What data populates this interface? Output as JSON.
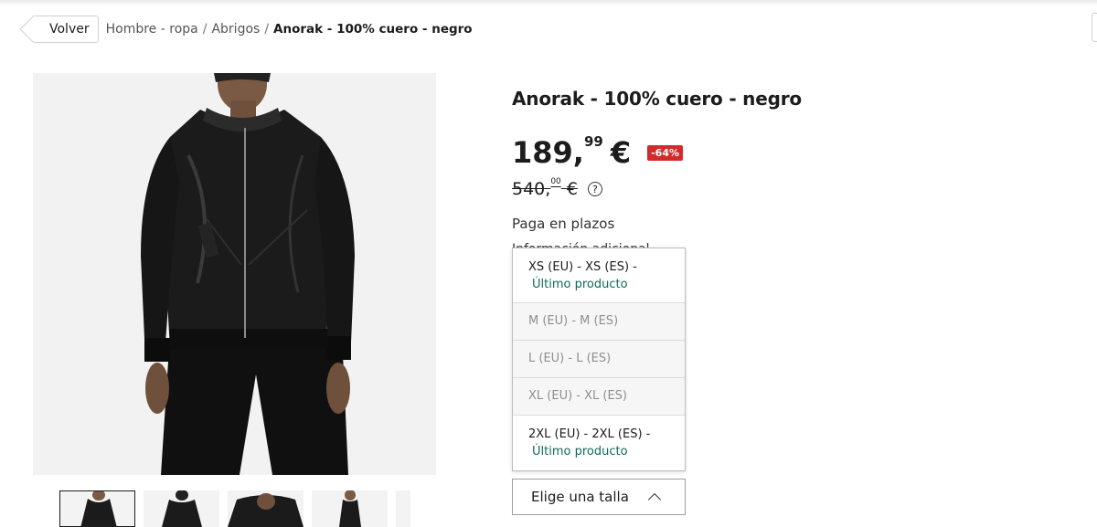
{
  "breadcrumb": {
    "back_label": "Volver",
    "items": [
      "Hombre - ropa",
      "Abrigos"
    ],
    "separator": "/",
    "current": "Anorak - 100% cuero - negro"
  },
  "product": {
    "title": "Anorak - 100% cuero - negro",
    "price": {
      "integer": "189,",
      "cents": "99",
      "currency": "€",
      "discount_badge": "-64%",
      "old_integer": "540,",
      "old_cents": "00",
      "old_currency": "€"
    },
    "installments_label": "Paga en plazos",
    "additional_info_label": "Información adicional"
  },
  "size_selector": {
    "label": "Elige una talla",
    "options": [
      {
        "label": "XS (EU) - XS (ES) -",
        "status": "Último producto",
        "available": true
      },
      {
        "label": "M (EU) - M (ES)",
        "status": "",
        "available": false
      },
      {
        "label": "L (EU) - L (ES)",
        "status": "",
        "available": false
      },
      {
        "label": "XL (EU) - XL (ES)",
        "status": "",
        "available": false
      },
      {
        "label": "2XL (EU) - 2XL (ES) -",
        "status": "Último producto",
        "available": true
      }
    ]
  },
  "gallery": {
    "thumbnails": [
      "front-view",
      "back-view",
      "detail-view",
      "side-view",
      "more"
    ]
  },
  "colors": {
    "discount": "#d22b2b",
    "availability": "#0e6b5a",
    "text": "#1c1c1c"
  }
}
